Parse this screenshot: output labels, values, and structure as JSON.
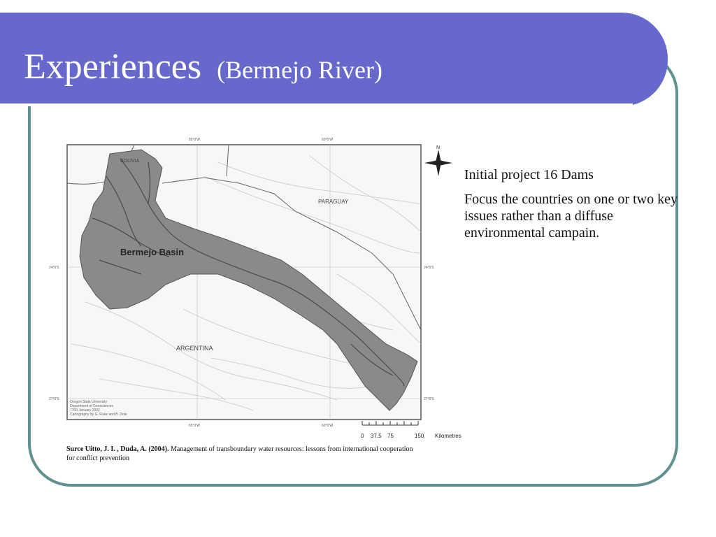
{
  "slide": {
    "title": "Experiences",
    "subtitle": "(Bermejo River)"
  },
  "colors": {
    "header": "#6768cc",
    "frame": "#5f9191",
    "basin": "#8a8a8a"
  },
  "map": {
    "basin_label": "Bermejo Basin",
    "country_labels": [
      "BOLIVIA",
      "PARAGUAY",
      "ARGENTINA"
    ],
    "lon_labels_top": [
      "65°0'W",
      "60°0'W"
    ],
    "lon_labels_bottom": [
      "65°0'W",
      "60°0'W"
    ],
    "lat_labels_left": [
      "24°0'S",
      "27°0'S"
    ],
    "lat_labels_right": [
      "24°0'S",
      "27°0'S"
    ],
    "credit_lines": [
      "Oregon State University",
      "Department of Geosciences",
      "7700 January 2002",
      "Cartography by G. Fiske and B. Dole"
    ],
    "north_label": "N",
    "scale_ticks": [
      "0",
      "37.5",
      "75",
      "150"
    ],
    "scale_unit": "Kilometres"
  },
  "bullets": [
    "Initial project 16 Dams",
    "Focus the countries on one or two key issues rather than a diffuse environmental campain."
  ],
  "source": {
    "authors": "Surce Uitto, J. I. , Duda, A. (2004).",
    "text": "Management of transboundary water resources: lessons from international cooperation for conflict prevention"
  }
}
